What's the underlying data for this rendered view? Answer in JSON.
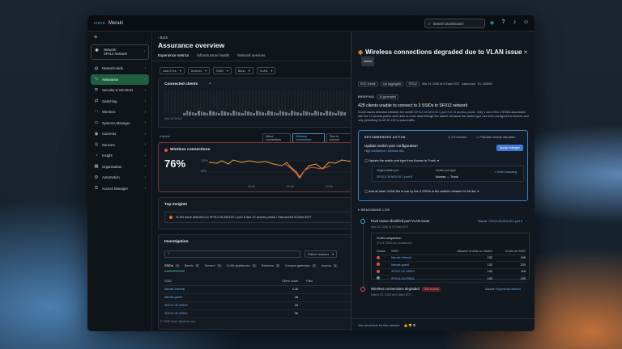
{
  "app": {
    "brand": "Meraki",
    "brand_prefix": "cisco",
    "search_placeholder": "Search Dashboard"
  },
  "sidebar": {
    "network_label": "Network",
    "network_name": "SF012 Network",
    "items": [
      {
        "label": "Network-wide",
        "icon": "globe-icon"
      },
      {
        "label": "Assurance",
        "icon": "pulse-icon",
        "active": true
      },
      {
        "label": "Security & SD-WAN",
        "icon": "shield-icon"
      },
      {
        "label": "Switching",
        "icon": "switch-icon"
      },
      {
        "label": "Wireless",
        "icon": "wifi-icon"
      },
      {
        "label": "Systems Manager",
        "icon": "device-icon"
      },
      {
        "label": "Cameras",
        "icon": "camera-icon"
      },
      {
        "label": "Sensors",
        "icon": "sensor-icon"
      },
      {
        "label": "Insight",
        "icon": "insight-icon"
      },
      {
        "label": "Organization",
        "icon": "building-icon"
      },
      {
        "label": "Automation",
        "icon": "automation-icon"
      },
      {
        "label": "Access Manager",
        "icon": "lock-icon"
      }
    ]
  },
  "main": {
    "back": "Back",
    "title": "Assurance overview",
    "tabs": [
      "Experience metrics",
      "Infrastructure health",
      "Network services"
    ],
    "filters": [
      "Last 2 hrs",
      "Devices",
      "SSID",
      "Band",
      "VLAN"
    ],
    "clients_title": "Connected clients",
    "clients_time": "Nov 10 22:00",
    "legend": [
      "Wired connections",
      "Wireless connections",
      "Time to connect"
    ],
    "collapse": "Active",
    "wireless_title": "Wireless connections",
    "wireless_kpi": "76%",
    "wireless_ticks": [
      "100%",
      "50%"
    ],
    "wireless_times": [
      "22:40",
      "22:45",
      "22:50"
    ],
    "insights_title": "Top Insights",
    "insight": "VLAN issue detected on SF012-05-MS130-1 port 8 and 12 access points • Discovered 9:23am EDT",
    "investigation_title": "Investigation",
    "failure_select": "Failure reasons",
    "subtabs": [
      {
        "label": "SSIDs",
        "count": "4"
      },
      {
        "label": "Bands",
        "count": "3"
      },
      {
        "label": "Servers",
        "count": "3"
      },
      {
        "label": "VLAN appliances",
        "count": "3"
      },
      {
        "label": "Switches",
        "count": "3"
      },
      {
        "label": "Campus gateways",
        "count": "2"
      },
      {
        "label": "Access",
        "count": "1"
      }
    ],
    "table_headers": [
      "SSID",
      "Client count",
      "Failu"
    ],
    "rows": [
      {
        "ssid": "Meraki-internal",
        "count": "1.1k"
      },
      {
        "ssid": "Meraki-guest",
        "count": "48"
      },
      {
        "ssid": "SF012-05-SSID2",
        "count": "16"
      },
      {
        "ssid": "SF012-05-SSID1",
        "count": "96"
      }
    ],
    "footer": "© 2026 Cisco Systems, Inc."
  },
  "panel": {
    "title": "Wireless connections degraded due to VLAN issue",
    "status": "Active",
    "meta": [
      "RCE create",
      "List aggregate",
      "SF012",
      "Mar 23, 2026 at 9:23am EDT",
      "Assurance",
      "ID: 205992"
    ],
    "briefing_label": "BRIEFING",
    "ai_label": "AI generated",
    "headline": "428 clients unable to connect to 3 SSIDs in SF012 network",
    "body_prefix": "VLAN issues detected between the switch ",
    "body_link": "SF012-05-MS130-1 port 8 & 13 access points",
    "body_suffix": ". Only 1 out of the 4 SSIDs associated with the 13 access points were able to route data through the switch, because the switch type has been configured to Access and only permitting VLAN ID 132 to pass traffic.",
    "rec": {
      "label": "RECOMMENDED ACTION",
      "time": "3-5 minutes",
      "disruption": "Potential network disruption",
      "title": "Update switch port configuration",
      "confidence": "High confidence • Medium risk",
      "apply": "Apply changes",
      "step1": "Update the switch port type from Access to Trunk.",
      "target_label": "Target switch port",
      "target_value": "SF012-05-MS130-1 port 8",
      "type_label": "Switch port type",
      "type_value": "Access → Trunk",
      "more": "More reasoning",
      "step2": "Add all other VLAN IDs in use by the 3 SSIDs to the switch's Allowed VLAN list."
    },
    "reasoning_label": "REASONING LOG",
    "root": {
      "title": "Root cause identified port VLAN issue",
      "time": "Mar 23, 2026 at 9:23am EDT",
      "source_label": "Source:",
      "source": "SF012-05-MS130-1 port 8"
    },
    "vlan": {
      "title": "VLAN comparison",
      "sub": "(3 of 4 SSIDs are unmatched)",
      "headers": [
        "Status",
        "SSID",
        "Allowed VLANs on Switch",
        "VLAN on SSID"
      ],
      "rows": [
        {
          "status": "red",
          "ssid": "Meraki-internal",
          "allowed": "132",
          "vlan": "106"
        },
        {
          "status": "red",
          "ssid": "Meraki-guest",
          "allowed": "132",
          "vlan": "220"
        },
        {
          "status": "red",
          "ssid": "SF012-05-SSID2",
          "allowed": "132",
          "vlan": "116"
        },
        {
          "status": "green",
          "ssid": "SF012-05-SSID1",
          "allowed": "132",
          "vlan": "132"
        }
      ]
    },
    "degraded": {
      "title": "Wireless connections degraded",
      "pill": "76% at peak",
      "time": "March 23, 2026 at 9:18am EDT",
      "source_label": "Source:",
      "source": "Experience Metrics"
    },
    "footer_link": "See all actions for this network"
  }
}
